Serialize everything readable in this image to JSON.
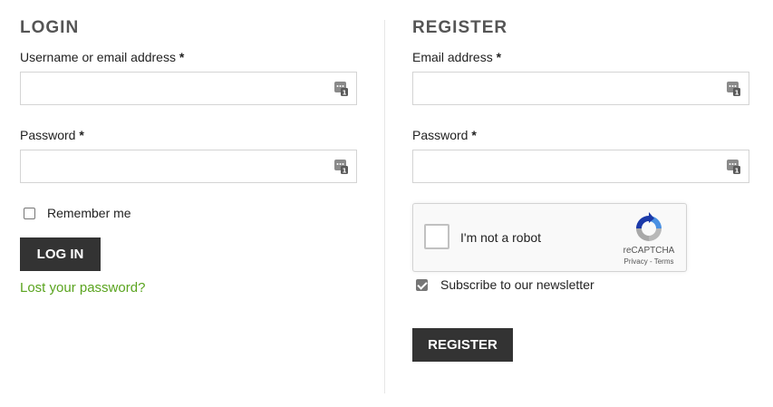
{
  "login": {
    "heading": "LOGIN",
    "username_label": "Username or email address",
    "password_label": "Password",
    "required_mark": "*",
    "username_value": "",
    "password_value": "",
    "remember_label": "Remember me",
    "remember_checked": false,
    "submit_label": "LOG IN",
    "lost_password_link": "Lost your password?"
  },
  "register": {
    "heading": "REGISTER",
    "email_label": "Email address",
    "password_label": "Password",
    "required_mark": "*",
    "email_value": "",
    "password_value": "",
    "recaptcha": {
      "label": "I'm not a robot",
      "brand": "reCAPTCHA",
      "privacy": "Privacy",
      "separator": " - ",
      "terms": "Terms"
    },
    "newsletter_label": "Subscribe to our newsletter",
    "newsletter_checked": true,
    "submit_label": "REGISTER"
  },
  "icons": {
    "field_icon": "password-manager-icon",
    "captcha_logo": "recaptcha-logo-icon"
  },
  "colors": {
    "button_bg": "#333333",
    "link": "#5aa41f",
    "heading": "#555555"
  }
}
